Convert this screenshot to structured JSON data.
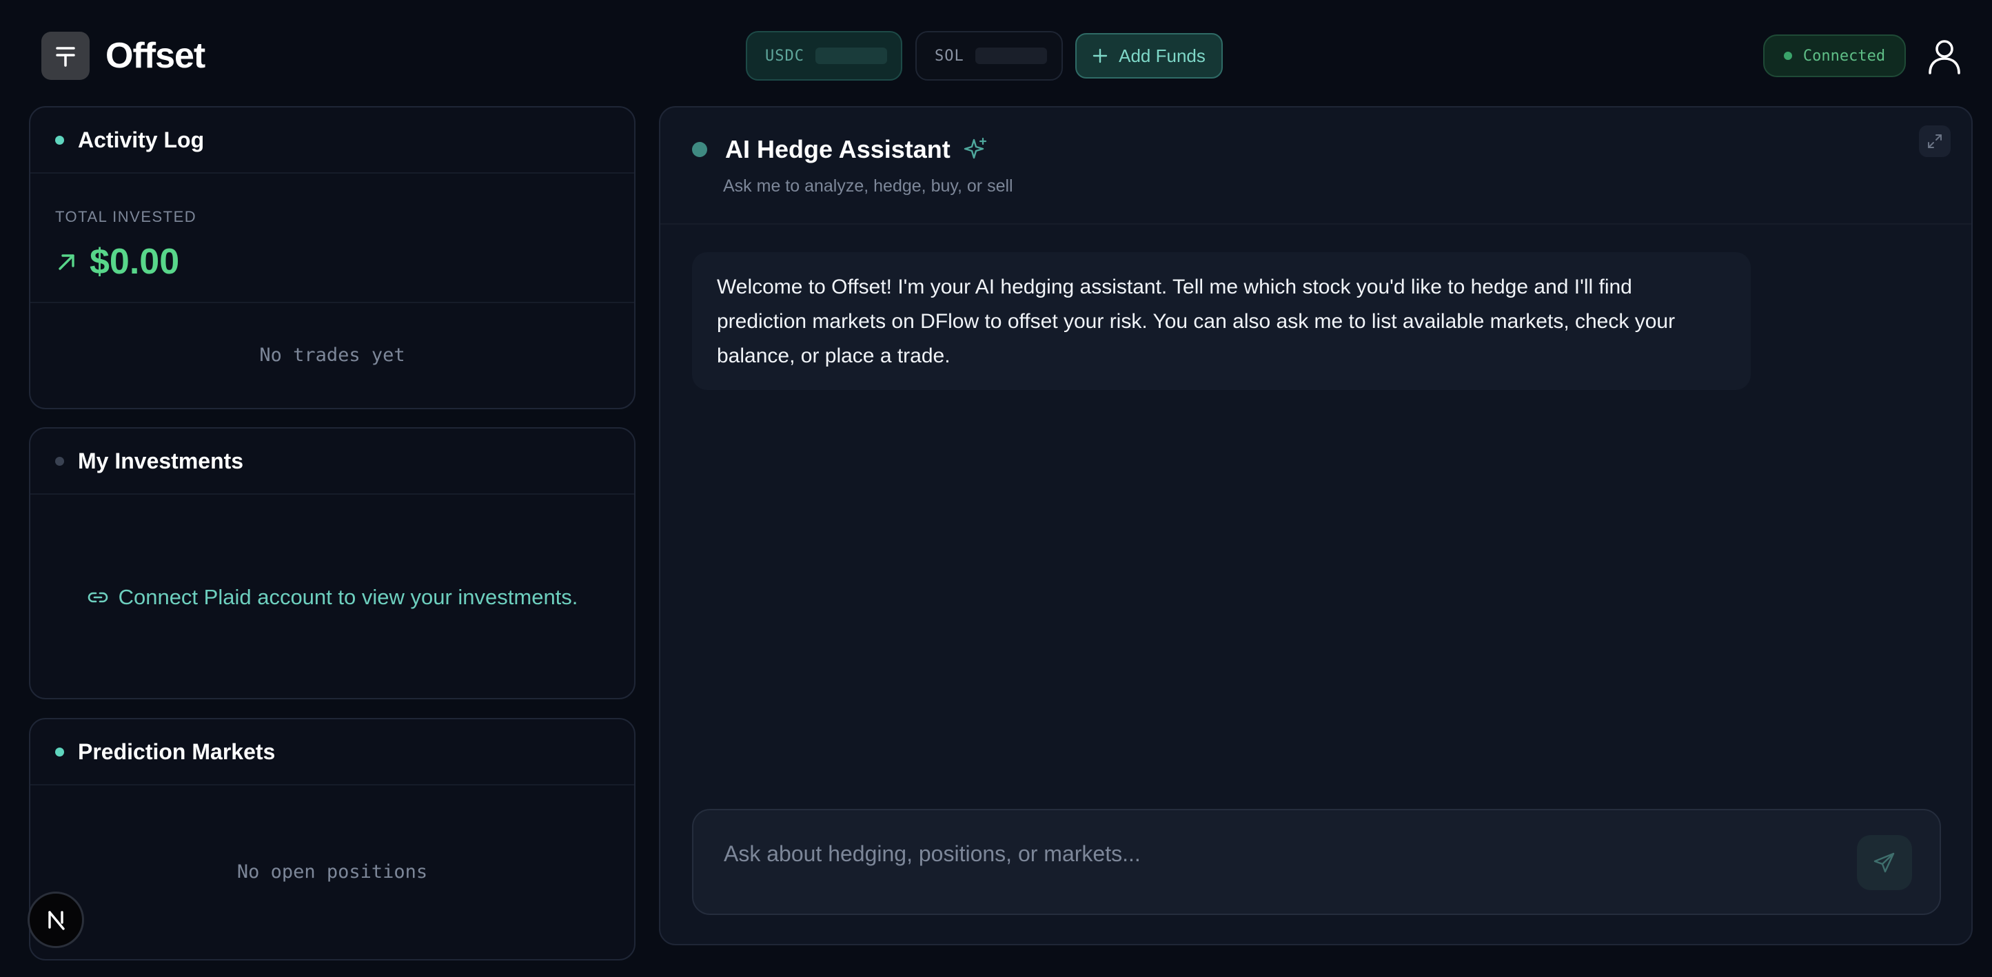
{
  "brand": {
    "name": "Offset",
    "icon": "plus-minus-icon"
  },
  "wallet": {
    "usdc_label": "USDC",
    "sol_label": "SOL",
    "add_funds_label": "Add Funds"
  },
  "status": {
    "connected_label": "Connected"
  },
  "activity_log": {
    "title": "Activity Log",
    "total_invested_label": "TOTAL INVESTED",
    "total_invested_value": "$0.00",
    "empty_message": "No trades yet"
  },
  "my_investments": {
    "title": "My Investments",
    "connect_link": "Connect Plaid account to view your investments."
  },
  "prediction_markets": {
    "title": "Prediction Markets",
    "empty_message": "No open positions"
  },
  "chat": {
    "title": "AI Hedge Assistant",
    "subtitle": "Ask me to analyze, hedge, buy, or sell",
    "welcome_message": "Welcome to Offset! I'm your AI hedging assistant. Tell me which stock you'd like to hedge and I'll find prediction markets on DFlow to offset your risk. You can also ask me to list available markets, check your balance, or place a trade.",
    "input_placeholder": "Ask about hedging, positions, or markets..."
  },
  "colors": {
    "background": "#080c15",
    "accent_teal": "#5fd5be",
    "positive_green": "#58d68a",
    "muted_text": "#7d8799"
  }
}
